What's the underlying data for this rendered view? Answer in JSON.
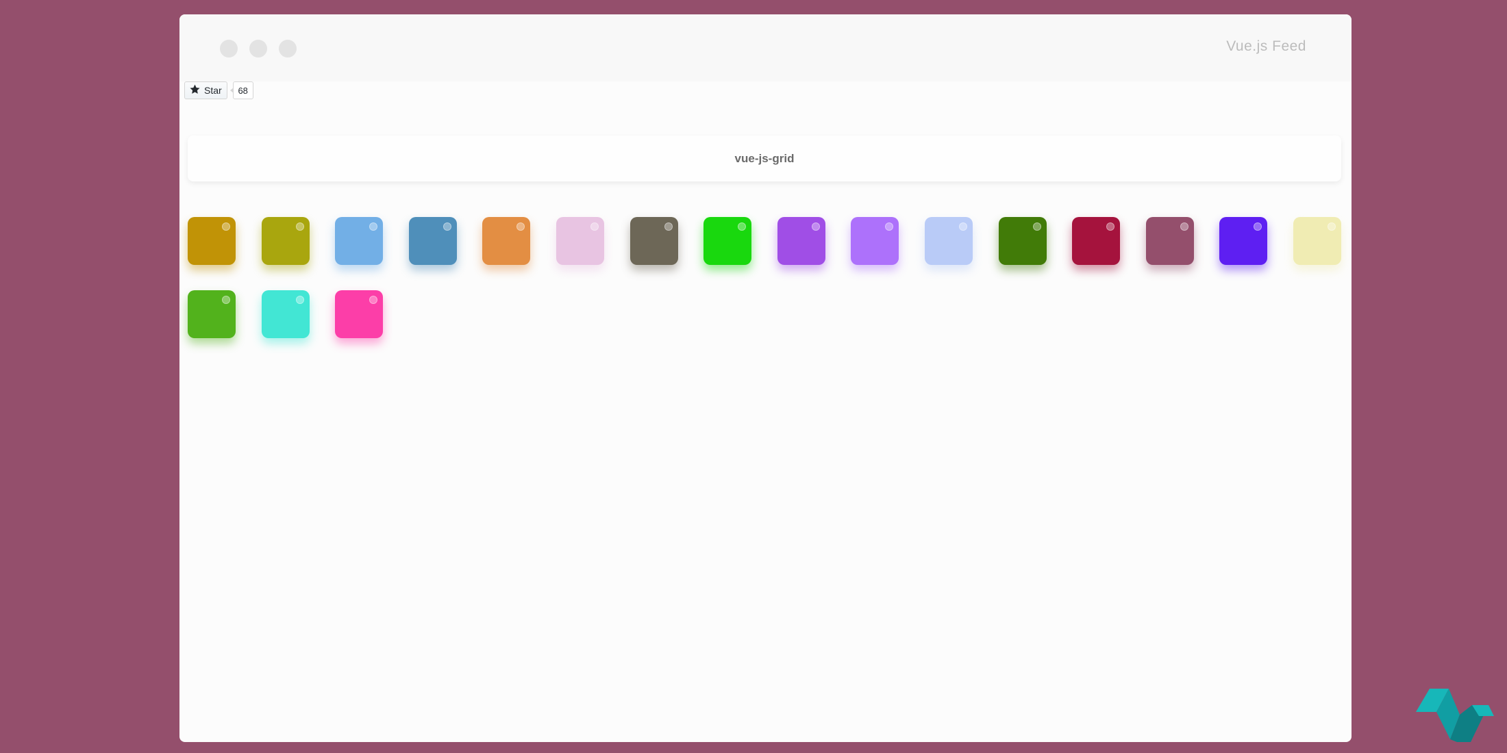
{
  "window": {
    "title": "Vue.js Feed"
  },
  "github": {
    "star_label": "Star",
    "star_count": "68"
  },
  "header": {
    "title": "vue-js-grid"
  },
  "tiles": [
    {
      "color": "#c19306"
    },
    {
      "color": "#a9a60e"
    },
    {
      "color": "#72afe6"
    },
    {
      "color": "#4f8fba"
    },
    {
      "color": "#e38e43"
    },
    {
      "color": "#e8c4e2"
    },
    {
      "color": "#6d6757"
    },
    {
      "color": "#19d80e"
    },
    {
      "color": "#a04ee6"
    },
    {
      "color": "#ad71fb"
    },
    {
      "color": "#b9cbf7"
    },
    {
      "color": "#417b08"
    },
    {
      "color": "#a5133d"
    },
    {
      "color": "#944f6c"
    },
    {
      "color": "#5e1ff2"
    },
    {
      "color": "#f0ecb3"
    },
    {
      "color": "#52b21c"
    },
    {
      "color": "#42e6d4"
    },
    {
      "color": "#fc3ea8"
    }
  ],
  "colors": {
    "background": "#944f6c",
    "logo_primary": "#17b7b9",
    "logo_dark": "#0e7f84"
  },
  "icons": {
    "star": "star-icon",
    "logo": "vue-feed-logo-icon"
  }
}
